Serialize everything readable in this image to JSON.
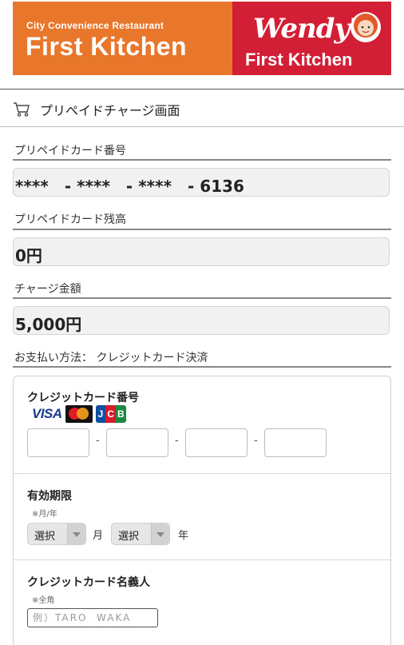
{
  "header": {
    "fk_tagline": "City Convenience Restaurant",
    "fk_brand": "First Kitchen",
    "wendys_brand": "Wendy's",
    "wendys_sub": "First Kitchen"
  },
  "page": {
    "title": "プリペイドチャージ画面"
  },
  "card_number": {
    "label": "プリペイドカード番号",
    "value": "****　- ****　- ****　- 6136"
  },
  "balance": {
    "label": "プリペイドカード残高",
    "value": "0円"
  },
  "charge_amount": {
    "label": "チャージ金額",
    "value": "5,000円"
  },
  "payment": {
    "label": "お支払い方法：  クレジットカード決済"
  },
  "credit_card": {
    "number_label": "クレジットカード番号",
    "brands": [
      "VISA",
      "MasterCard",
      "JCB"
    ],
    "separators": [
      "-",
      "-",
      "-"
    ],
    "expiry_label": "有効期限",
    "expiry_note": "※月/年",
    "month_select": "選択",
    "month_unit": "月",
    "year_select": "選択",
    "year_unit": "年",
    "holder_label": "クレジットカード名義人",
    "holder_note": "※全角",
    "holder_placeholder": "例）TARO  WAKA"
  },
  "colors": {
    "first_kitchen_orange": "#E8762B",
    "wendys_red": "#D21F36"
  }
}
